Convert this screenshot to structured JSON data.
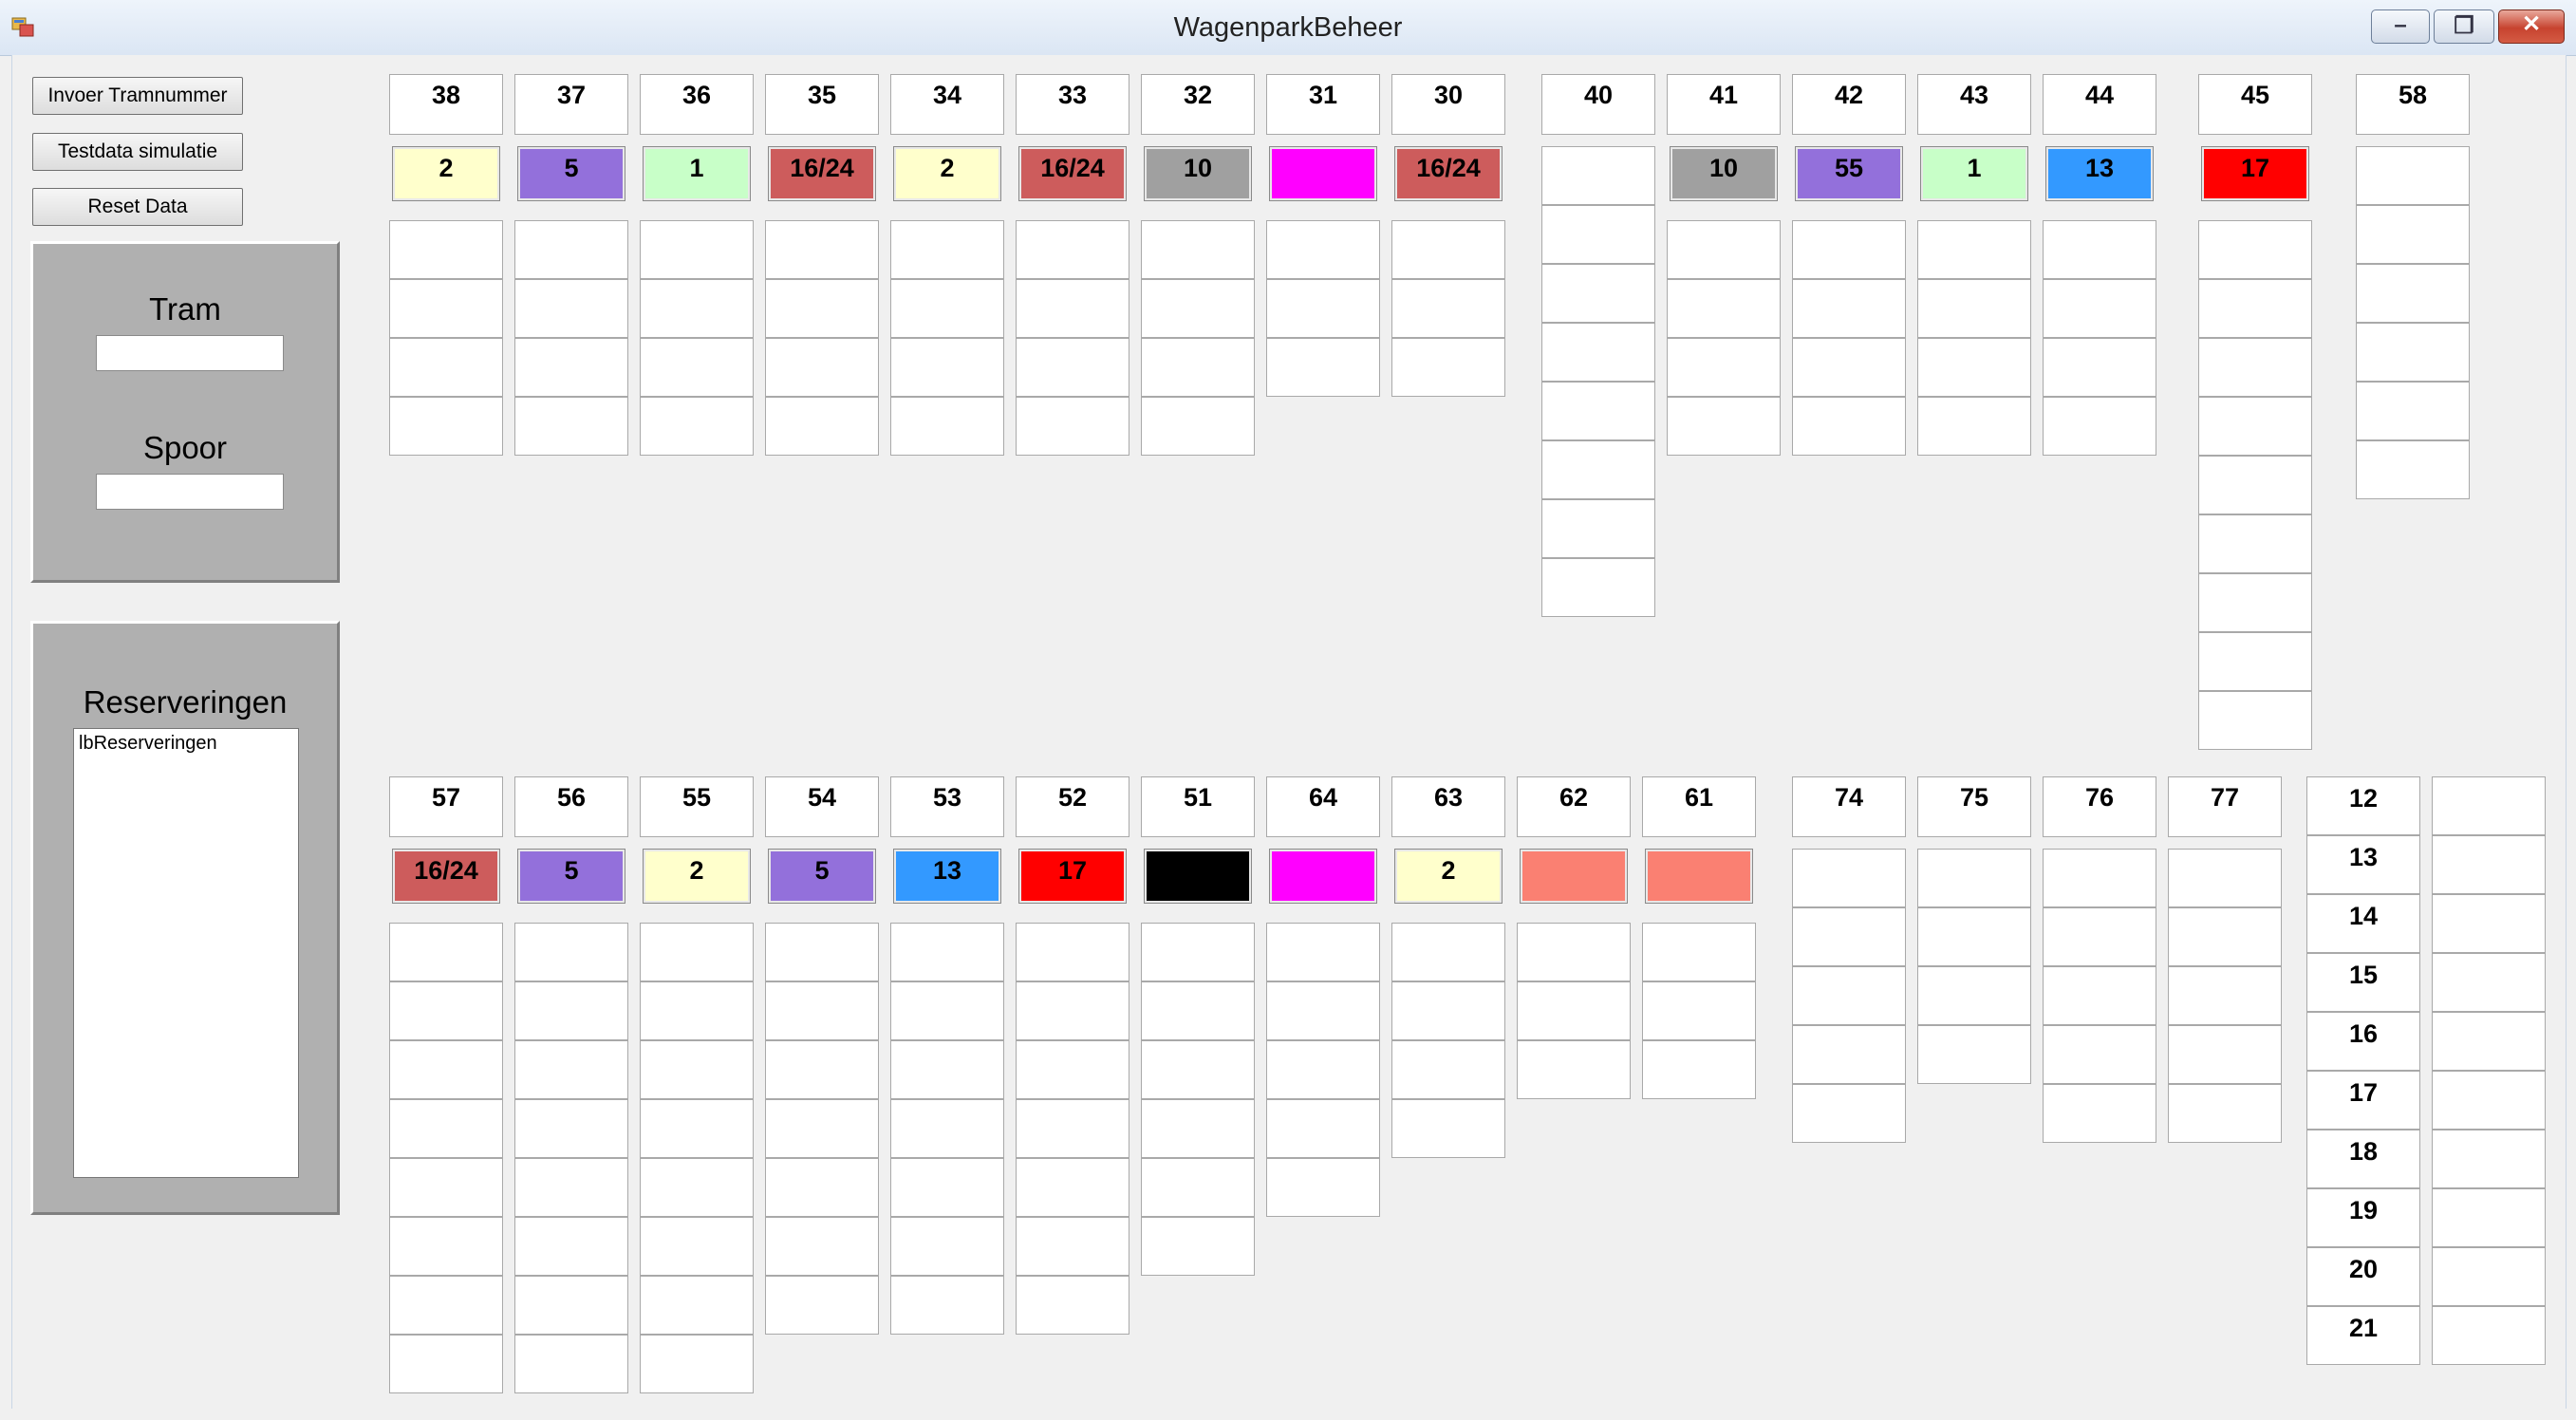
{
  "window": {
    "title": "WagenparkBeheer"
  },
  "buttons": {
    "invoer": "Invoer Tramnummer",
    "testdata": "Testdata simulatie",
    "reset": "Reset Data"
  },
  "form": {
    "tram_label": "Tram",
    "spoor_label": "Spoor"
  },
  "reservations": {
    "title": "Reserveringen",
    "list_text": "lbReserveringen"
  },
  "colors": {
    "yellow": "#ffffcc",
    "purple": "#9370db",
    "green": "#c8ffc8",
    "brick": "#cd5c5c",
    "gray": "#a0a0a0",
    "magenta": "#ff00ff",
    "blue": "#3399ff",
    "red": "#ff0000",
    "black": "#000000",
    "salmon": "#fa8072"
  },
  "tracks_top": [
    {
      "track": "38",
      "tram": "2",
      "color": "yellow",
      "cells": 4
    },
    {
      "track": "37",
      "tram": "5",
      "color": "purple",
      "cells": 4
    },
    {
      "track": "36",
      "tram": "1",
      "color": "green",
      "cells": 4
    },
    {
      "track": "35",
      "tram": "16/24",
      "color": "brick",
      "cells": 4
    },
    {
      "track": "34",
      "tram": "2",
      "color": "yellow",
      "cells": 4
    },
    {
      "track": "33",
      "tram": "16/24",
      "color": "brick",
      "cells": 4
    },
    {
      "track": "32",
      "tram": "10",
      "color": "gray",
      "cells": 4
    },
    {
      "track": "31",
      "tram": "",
      "color": "magenta",
      "cells": 3
    },
    {
      "track": "30",
      "tram": "16/24",
      "color": "brick",
      "cells": 3
    },
    {
      "track": "40",
      "tram": null,
      "color": null,
      "cells": 8
    },
    {
      "track": "41",
      "tram": "10",
      "color": "gray",
      "cells": 4
    },
    {
      "track": "42",
      "tram": "55",
      "color": "purple",
      "cells": 4
    },
    {
      "track": "43",
      "tram": "1",
      "color": "green",
      "cells": 4
    },
    {
      "track": "44",
      "tram": "13",
      "color": "blue",
      "cells": 4
    },
    {
      "track": "45",
      "tram": "17",
      "color": "red",
      "cells": 9
    },
    {
      "track": "58",
      "tram": null,
      "color": null,
      "cells": 6
    }
  ],
  "tracks_bottom": [
    {
      "track": "57",
      "tram": "16/24",
      "color": "brick",
      "cells": 8
    },
    {
      "track": "56",
      "tram": "5",
      "color": "purple",
      "cells": 8
    },
    {
      "track": "55",
      "tram": "2",
      "color": "yellow",
      "cells": 8
    },
    {
      "track": "54",
      "tram": "5",
      "color": "purple",
      "cells": 7
    },
    {
      "track": "53",
      "tram": "13",
      "color": "blue",
      "cells": 7
    },
    {
      "track": "52",
      "tram": "17",
      "color": "red",
      "cells": 7
    },
    {
      "track": "51",
      "tram": "",
      "color": "black",
      "cells": 6
    },
    {
      "track": "64",
      "tram": "",
      "color": "magenta",
      "cells": 5
    },
    {
      "track": "63",
      "tram": "2",
      "color": "yellow",
      "cells": 4
    },
    {
      "track": "62",
      "tram": "",
      "color": "salmon",
      "cells": 3
    },
    {
      "track": "61",
      "tram": "",
      "color": "salmon",
      "cells": 3
    },
    {
      "track": "74",
      "tram": null,
      "color": null,
      "cells": 5
    },
    {
      "track": "75",
      "tram": null,
      "color": null,
      "cells": 4
    },
    {
      "track": "76",
      "tram": null,
      "color": null,
      "cells": 5
    },
    {
      "track": "77",
      "tram": null,
      "color": null,
      "cells": 5
    }
  ],
  "track_numbers": [
    "12",
    "13",
    "14",
    "15",
    "16",
    "17",
    "18",
    "19",
    "20",
    "21"
  ]
}
